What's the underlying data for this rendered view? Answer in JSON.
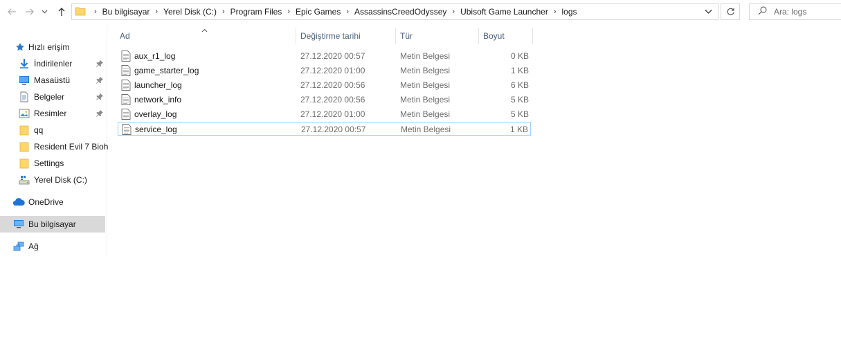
{
  "address": {
    "crumbs": [
      "Bu bilgisayar",
      "Yerel Disk (C:)",
      "Program Files",
      "Epic Games",
      "AssassinsCreedOdyssey",
      "Ubisoft Game Launcher",
      "logs"
    ]
  },
  "search": {
    "placeholder": "Ara: logs"
  },
  "nav": {
    "quick_access": "Hızlı erişim",
    "items": [
      {
        "label": "İndirilenler",
        "icon": "download-icon",
        "pinned": true
      },
      {
        "label": "Masaüstü",
        "icon": "desktop-icon",
        "pinned": true
      },
      {
        "label": "Belgeler",
        "icon": "documents-icon",
        "pinned": true
      },
      {
        "label": "Resimler",
        "icon": "pictures-icon",
        "pinned": true
      },
      {
        "label": "qq",
        "icon": "folder-icon",
        "pinned": false
      },
      {
        "label": "Resident Evil 7 Bioh",
        "icon": "folder-icon",
        "pinned": false
      },
      {
        "label": "Settings",
        "icon": "folder-icon",
        "pinned": false
      },
      {
        "label": "Yerel Disk (C:)",
        "icon": "drive-icon",
        "pinned": false
      }
    ],
    "onedrive": "OneDrive",
    "this_pc": "Bu bilgisayar",
    "network": "Ağ"
  },
  "columns": {
    "name": "Ad",
    "date": "Değiştirme tarihi",
    "type": "Tür",
    "size": "Boyut"
  },
  "files": [
    {
      "name": "aux_r1_log",
      "date": "27.12.2020 00:57",
      "type": "Metin Belgesi",
      "size": "0 KB"
    },
    {
      "name": "game_starter_log",
      "date": "27.12.2020 01:00",
      "type": "Metin Belgesi",
      "size": "1 KB"
    },
    {
      "name": "launcher_log",
      "date": "27.12.2020 00:56",
      "type": "Metin Belgesi",
      "size": "6 KB"
    },
    {
      "name": "network_info",
      "date": "27.12.2020 00:56",
      "type": "Metin Belgesi",
      "size": "5 KB"
    },
    {
      "name": "overlay_log",
      "date": "27.12.2020 01:00",
      "type": "Metin Belgesi",
      "size": "5 KB"
    },
    {
      "name": "service_log",
      "date": "27.12.2020 00:57",
      "type": "Metin Belgesi",
      "size": "1 KB"
    }
  ],
  "colors": {
    "accent": "#0078d7",
    "selected_bg": "#d9d9d9",
    "focus_border": "#99d1ff",
    "header_text": "#4c607a"
  }
}
